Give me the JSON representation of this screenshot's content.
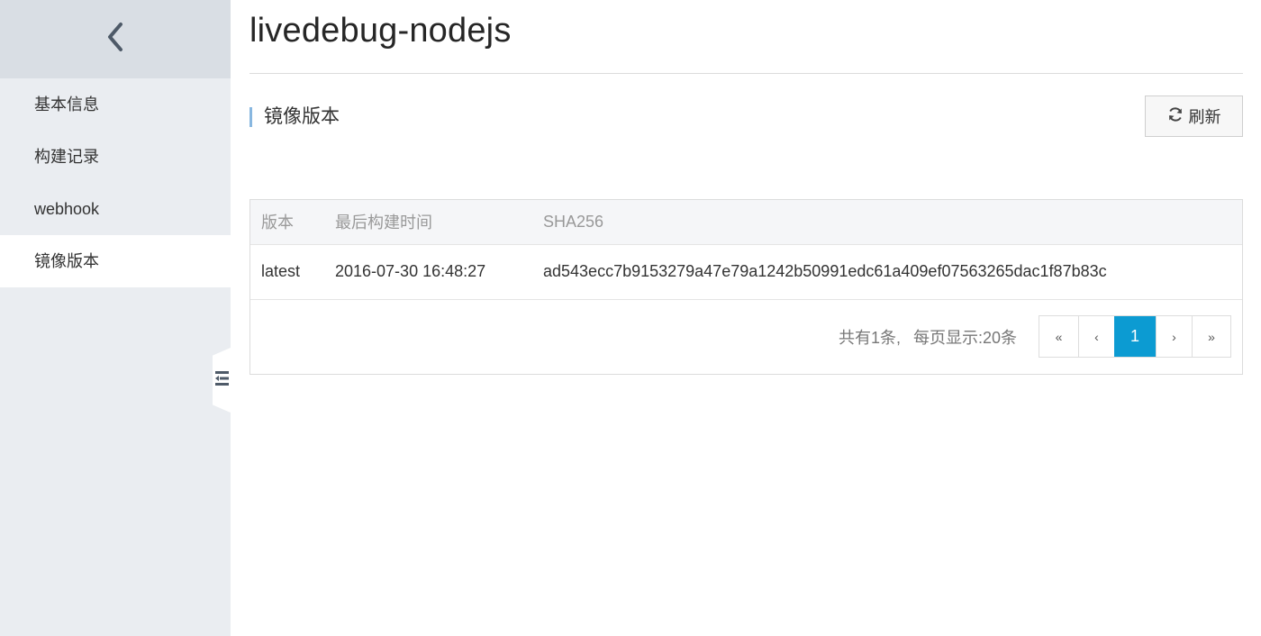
{
  "sidebar": {
    "items": [
      {
        "label": "基本信息",
        "active": false
      },
      {
        "label": "构建记录",
        "active": false
      },
      {
        "label": "webhook",
        "active": false
      },
      {
        "label": "镜像版本",
        "active": true
      }
    ]
  },
  "header": {
    "title": "livedebug-nodejs"
  },
  "section": {
    "title": "镜像版本",
    "refresh_label": "刷新"
  },
  "table": {
    "columns": [
      "版本",
      "最后构建时间",
      "SHA256"
    ],
    "rows": [
      [
        "latest",
        "2016-07-30 16:48:27",
        "ad543ecc7b9153279a47e79a1242b50991edc61a409ef07563265dac1f87b83c"
      ]
    ]
  },
  "pagination": {
    "total_text": "共有1条,",
    "per_page_text": "每页显示:20条",
    "first": "«",
    "prev": "‹",
    "current": "1",
    "next": "›",
    "last": "»"
  },
  "colors": {
    "accent": "#0c9bd2",
    "sidebar_bg": "#eaedf1",
    "sidebar_header_bg": "#d9dee4",
    "section_marker": "#88b7e0"
  },
  "icons": {
    "back": "chevron-left-icon",
    "refresh": "refresh-icon",
    "collapse": "collapse-menu-icon"
  }
}
